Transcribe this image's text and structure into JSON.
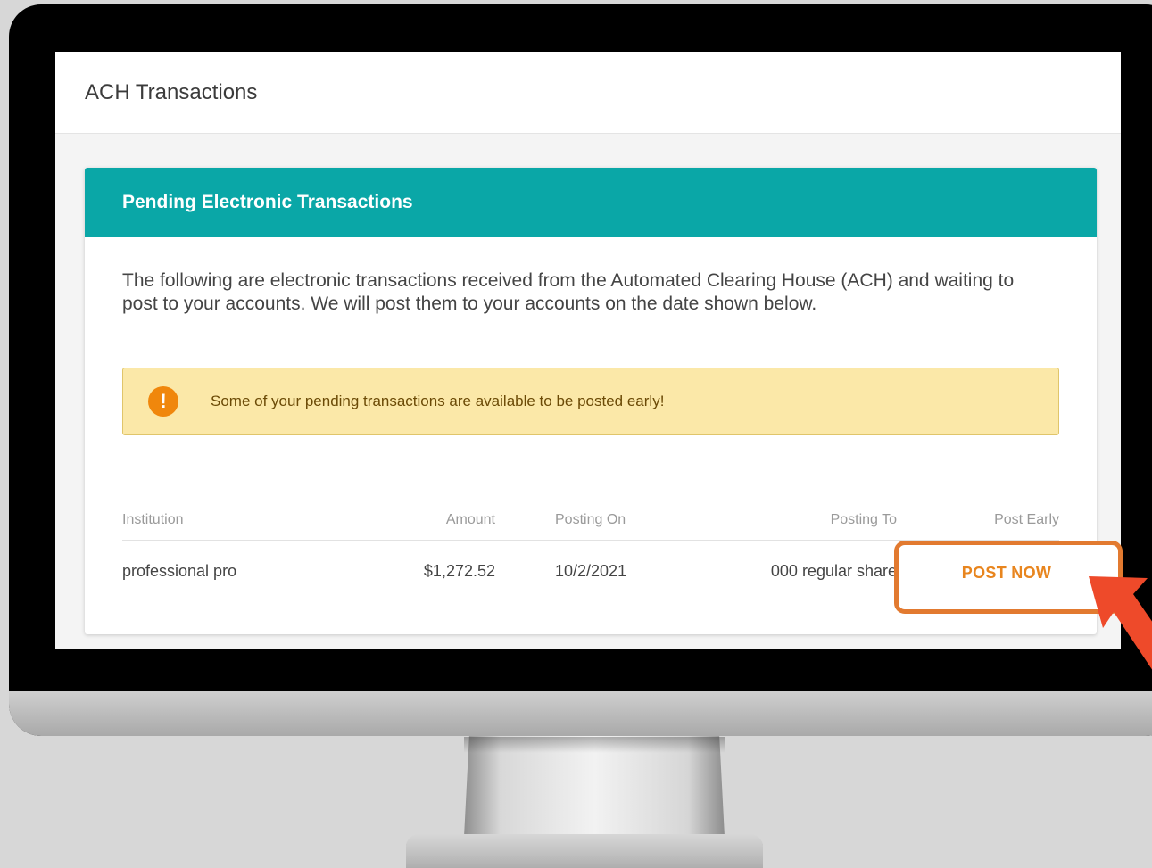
{
  "page": {
    "title": "ACH Transactions"
  },
  "card": {
    "title": "Pending Electronic Transactions",
    "description": "The following are electronic transactions received from the Automated Clearing House (ACH) and waiting to post to your accounts. We will post them to your accounts on the date shown below."
  },
  "alert": {
    "icon": "exclamation-icon",
    "text": "Some of your pending transactions are available to be posted early!"
  },
  "table": {
    "columns": [
      "Institution",
      "Amount",
      "Posting On",
      "Posting To",
      "Post Early"
    ],
    "rows": [
      {
        "institution": "professional pro",
        "amount": "$1,272.52",
        "posting_on": "10/2/2021",
        "posting_to": "000 regular share",
        "action": "POST NOW"
      }
    ]
  },
  "colors": {
    "header_teal": "#0aa7a7",
    "alert_bg": "#fbe8a8",
    "alert_icon": "#f0870c",
    "action_orange": "#e8851e",
    "annotation_orange": "#e27a30",
    "arrow_red": "#ee4a2a"
  }
}
